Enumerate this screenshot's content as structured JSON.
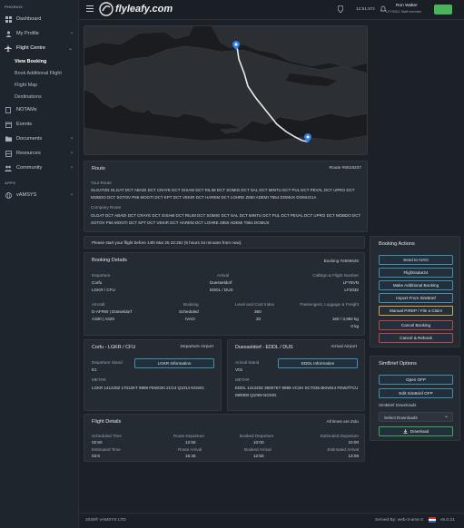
{
  "sidebar": {
    "section_main": "PHOENIX",
    "section_apps": "APPS",
    "items": [
      {
        "label": "Dashboard"
      },
      {
        "label": "My Profile"
      },
      {
        "label": "Flight Centre"
      },
      {
        "label": "NOTAMs"
      },
      {
        "label": "Events"
      },
      {
        "label": "Documents"
      },
      {
        "label": "Resources"
      },
      {
        "label": "Community"
      },
      {
        "label": "vAMSYS"
      }
    ],
    "sub_items": [
      {
        "label": "View Booking"
      },
      {
        "label": "Book Additional Flight"
      },
      {
        "label": "Flight Map"
      },
      {
        "label": "Destinations"
      }
    ]
  },
  "topbar": {
    "logo": "flyleafy.com",
    "time": "12:51:57z",
    "user_name": "Ron Walter",
    "user_role": "LFY0001 Staff member"
  },
  "route": {
    "title": "Route",
    "route_no": "Route #5519237",
    "your_route_label": "Your Route",
    "your_route": "OLGAT2N OLGAT DCT ABADI DCT CRAYE DCT GISAM DCT RILIM DCT SOMIG DCT SAL DCT MINTU DCT PUL DCT PEVAL DCT UPRO DCT MOBDO DCT SOTOV P66 MOGTI DCT KPT DCT VEKIR DCT HAREM DCT LOHRE Z850 ADEMI T854 DOMUX DOMUX1A",
    "company_route_label": "Company Route",
    "company_route": "OLGAT DCT ABADI DCT CRAYE DCT GISAM DCT RILIM DCT SOMIG DCT SAL DCT MINTU DCT PUL DCT PEVAL DCT UPRO DCT MOBDO DCT SOTOV P66 MOGTI DCT KPT DCT VEKIR DCT HAREM DCT LOHRE Z850 ADEMI T854 DOMUX"
  },
  "notice": "Please start your flight before 14th Mar 25 22:26z (9 hours 34 minutes from now).",
  "booking": {
    "title": "Booking Details",
    "booking_no": "Booking #2668626",
    "departure_label": "Departure",
    "departure_city": "Corfu",
    "departure_code": "LGKR / CFU",
    "arrival_label": "Arrival",
    "arrival_city": "Duesseldorf",
    "arrival_code": "EDDL / DUS",
    "callsign_label": "Callsign & Flight Number",
    "callsign": "LFY8VN",
    "flight_number": "LF2032",
    "aircraft_label": "Aircraft",
    "aircraft_reg": "D-AFRW | Düsseldorf",
    "aircraft_type": "A320 | A320",
    "booking_label": "Booking",
    "booking_status": "Scheduled",
    "booking_network": "IVAO",
    "level_label": "Level and Cost Index",
    "level": "360",
    "cost_index": "20",
    "pax_label": "Passengers, Luggage & Freight",
    "pax": "160 / 3,992 kg",
    "freight": "0 kg"
  },
  "actions": {
    "title": "Booking Actions",
    "buttons": [
      "Send to IVAO",
      "Flightradar24",
      "Make Additional Booking",
      "Import From SimBrief",
      "Manual PIREP / File a Claim",
      "Cancel Booking",
      "Cancel & Rebook"
    ]
  },
  "dep_airport": {
    "title": "Corfu - LGKR / CFU",
    "tag": "Departure Airport",
    "stand_label": "Departure Stand",
    "stand": "E1",
    "info_button": "LGKR Information",
    "metar_label": "METAR",
    "metar": "LGKR 141220Z 17012KT 9999 FEW020 21/13 Q1014 NOSIG"
  },
  "arr_airport": {
    "title": "Duesseldorf - EDDL / DUS",
    "tag": "Arrival Airport",
    "stand_label": "Arrival Stand",
    "stand": "V01",
    "info_button": "EDDL Information",
    "metar_label": "METAR",
    "metar": "EDDL 141220Z 36007KT 9999 VCSH SCT035 BKN044 FEW///TCU 08/M00 Q1009 NOSIG"
  },
  "simbrief": {
    "title": "SimBrief Options",
    "open": "Open OFP",
    "edit": "Edit SimBrief OFP",
    "downloads_label": "SimBrief Downloads",
    "select_placeholder": "Select Downloads",
    "download": "Download"
  },
  "flight_details": {
    "title": "Flight Details",
    "tz": "All times are Zulu",
    "headers": [
      "Scheduled Time",
      "Route Departure",
      "Booked Departure",
      "Estimated Departure"
    ],
    "row1": [
      "02:50",
      "12:55",
      "10:00",
      "10:00"
    ],
    "headers2": [
      "Estimated Time",
      "Route Arrival",
      "Booked Arrival",
      "Estimated Arrival"
    ],
    "row2": [
      "03:6",
      "15:45",
      "12:50",
      "13:06"
    ]
  },
  "footer": {
    "copyright": "2025® vAMSYS LTD",
    "served": "Served By: web-3-ams-3",
    "version": "v5.0.21"
  },
  "colors": {
    "accent": "#3e8fb0",
    "warn": "#d2a64a",
    "danger": "#c2454a",
    "ok": "#3cab5a"
  }
}
